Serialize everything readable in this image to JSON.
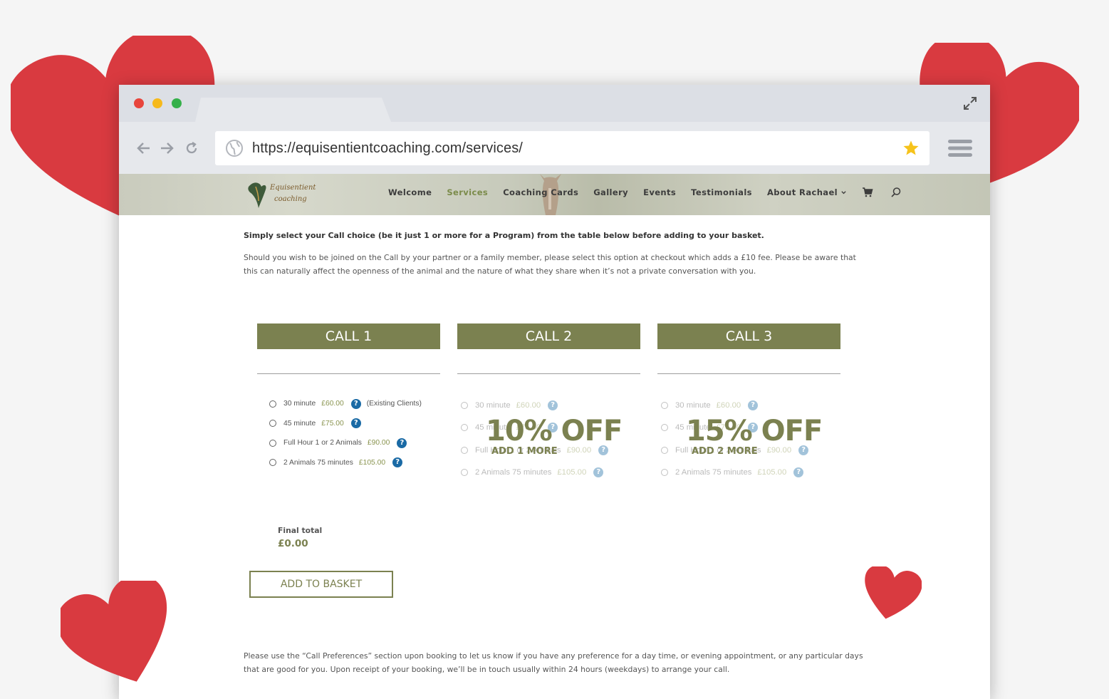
{
  "browser": {
    "url": "https://equisentientcoaching.com/services/"
  },
  "nav": {
    "logo_text": "Equisentient Coaching",
    "items": [
      {
        "label": "Welcome"
      },
      {
        "label": "Services"
      },
      {
        "label": "Coaching Cards"
      },
      {
        "label": "Gallery"
      },
      {
        "label": "Events"
      },
      {
        "label": "Testimonials"
      },
      {
        "label": "About Rachael"
      }
    ],
    "active": "Services"
  },
  "intro": {
    "bold": "Simply select your Call choice (be it just 1 or more for a Program) from the table below before adding to your basket.",
    "paragraph": "Should you wish to be joined on the Call by your partner or a family member, please select this option at checkout which adds a £10 fee. Please be aware that this can naturally affect the openness of the animal and the nature of what they share when it’s not a private conversation with you."
  },
  "calls": [
    {
      "title": "CALL 1",
      "options": [
        {
          "label": "30 minute",
          "price": "£60.00",
          "note": "(Existing Clients)"
        },
        {
          "label": "45 minute",
          "price": "£75.00",
          "note": ""
        },
        {
          "label": "Full Hour 1 or 2 Animals",
          "price": "£90.00",
          "note": ""
        },
        {
          "label": "2 Animals 75 minutes",
          "price": "£105.00",
          "note": ""
        }
      ]
    },
    {
      "title": "CALL 2",
      "discount": "10% OFF",
      "discount_sub": "ADD 1 MORE",
      "options": [
        {
          "label": "30 minute",
          "price": "£60.00"
        },
        {
          "label": "45 minute",
          "price": "£75.00"
        },
        {
          "label": "Full Hour 1 or 2 Animals",
          "price": "£90.00"
        },
        {
          "label": "2 Animals 75 minutes",
          "price": "£105.00"
        }
      ]
    },
    {
      "title": "CALL 3",
      "discount": "15% OFF",
      "discount_sub": "ADD 2 MORE",
      "options": [
        {
          "label": "30 minute",
          "price": "£60.00"
        },
        {
          "label": "45 minute",
          "price": "£75.00"
        },
        {
          "label": "Full Hour 1 or 2 Animals",
          "price": "£90.00"
        },
        {
          "label": "2 Animals 75 minutes",
          "price": "£105.00"
        }
      ]
    }
  ],
  "total": {
    "label": "Final total",
    "value": "£0.00"
  },
  "basket_button": "ADD TO BASKET",
  "note": "Please use the “Call Preferences” section upon booking to let us know if you have any preference for a day time, or evening appointment, or any particular days that are good for you. Upon receipt of your booking, we’ll be in touch usually within 24 hours (weekdays) to arrange your call.",
  "colors": {
    "accent": "#7b8150",
    "heart": "#d93a40",
    "help": "#1a6aa5"
  }
}
